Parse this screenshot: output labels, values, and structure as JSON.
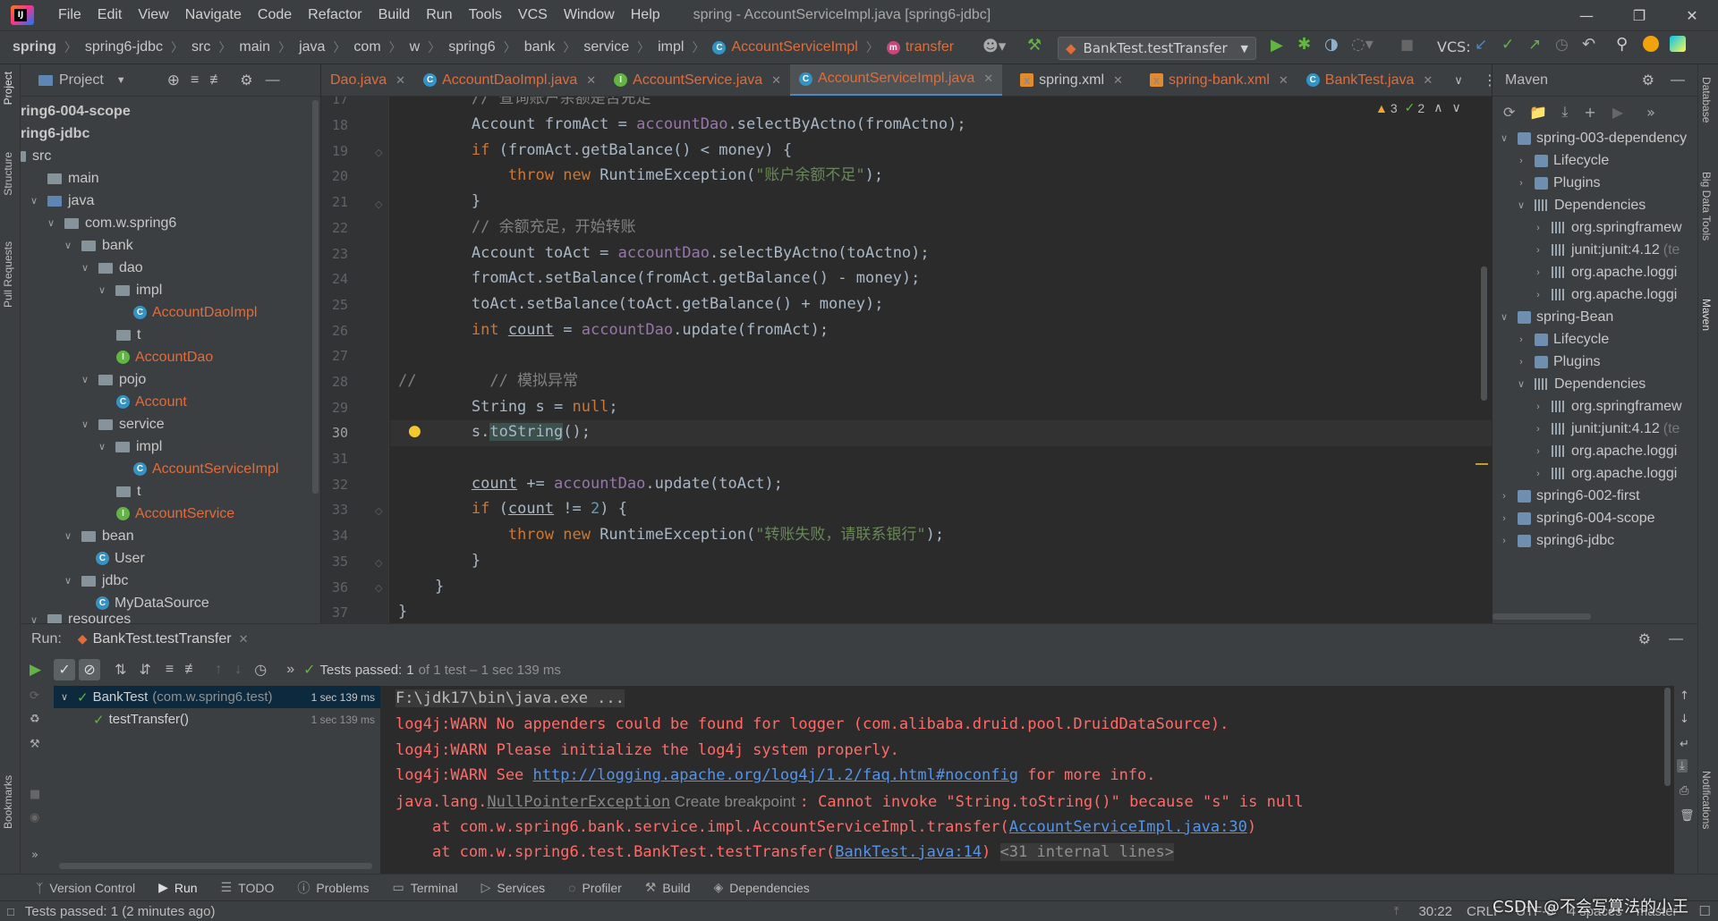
{
  "menubar": {
    "items": [
      "File",
      "Edit",
      "View",
      "Navigate",
      "Code",
      "Refactor",
      "Build",
      "Run",
      "Tools",
      "VCS",
      "Window",
      "Help"
    ],
    "title": "spring - AccountServiceImpl.java [spring6-jdbc]"
  },
  "navbar": {
    "crumbs": [
      "spring",
      "spring6-jdbc",
      "src",
      "main",
      "java",
      "com",
      "w",
      "spring6",
      "bank",
      "service",
      "impl"
    ],
    "class_crumb": "AccountServiceImpl",
    "method_crumb": "transfer",
    "run_config": "BankTest.testTransfer",
    "vcs_label": "VCS:"
  },
  "left_strip": {
    "tabs": [
      "Project",
      "Structure",
      "Pull Requests",
      "Bookmarks"
    ]
  },
  "project": {
    "title": "Project",
    "rows": [
      "ring6-004-scope",
      "ring6-jdbc",
      "src",
      "main",
      "java",
      "com.w.spring6",
      "bank",
      "dao",
      "impl",
      "AccountDaoImpl",
      "t",
      "AccountDao",
      "pojo",
      "Account",
      "service",
      "impl",
      "AccountServiceImpl",
      "t",
      "AccountService",
      "bean",
      "User",
      "jdbc",
      "MyDataSource",
      "resources"
    ]
  },
  "tabs": [
    {
      "name": "Dao.java"
    },
    {
      "name": "AccountDaoImpl.java"
    },
    {
      "name": "AccountService.java"
    },
    {
      "name": "AccountServiceImpl.java"
    },
    {
      "name": "spring.xml"
    },
    {
      "name": "spring-bank.xml"
    },
    {
      "name": "BankTest.java"
    }
  ],
  "editor": {
    "warnings": "3",
    "weak_warnings": "2",
    "line_numbers": [
      "17",
      "18",
      "19",
      "20",
      "21",
      "22",
      "23",
      "24",
      "25",
      "26",
      "27",
      "28",
      "29",
      "30",
      "31",
      "32",
      "33",
      "34",
      "35",
      "36",
      "37"
    ],
    "current_line": "30"
  },
  "maven": {
    "title": "Maven",
    "rows": [
      "spring-003-dependency",
      "Lifecycle",
      "Plugins",
      "Dependencies",
      "org.springframew",
      "junit:junit:4.12",
      "org.apache.loggi",
      "org.apache.loggi",
      "spring-Bean",
      "Lifecycle",
      "Plugins",
      "Dependencies",
      "org.springframew",
      "junit:junit:4.12",
      "org.apache.loggi",
      "org.apache.loggi",
      "spring6-002-first",
      "spring6-004-scope",
      "spring6-jdbc"
    ],
    "junit_suffix": "(te"
  },
  "right_strip": {
    "tabs": [
      "Database",
      "Big Data Tools",
      "Maven",
      "Notifications"
    ]
  },
  "run": {
    "label": "Run:",
    "tab": "BankTest.testTransfer",
    "status": "Tests passed:",
    "status_count": "1",
    "status_rest": "of 1 test – 1 sec 139 ms",
    "tree": [
      {
        "name": "BankTest",
        "detail": "(com.w.spring6.test)",
        "time": "1 sec 139 ms"
      },
      {
        "name": "testTransfer()",
        "detail": "",
        "time": "1 sec 139 ms"
      }
    ],
    "console": {
      "cmd": "F:\\jdk17\\bin\\java.exe ...",
      "warn1": "log4j:WARN No appenders could be found for logger (com.alibaba.druid.pool.DruidDataSource).",
      "warn2": "log4j:WARN Please initialize the log4j system properly.",
      "warn3_pre": "log4j:WARN See ",
      "warn3_link": "http://logging.apache.org/log4j/1.2/faq.html#noconfig",
      "warn3_post": " for more info.",
      "exc_pre": "java.lang.",
      "exc_name": "NullPointerException",
      "exc_bp": " Create breakpoint ",
      "exc_msg": ": Cannot invoke \"String.toString()\" because \"s\" is null",
      "at1_pre": "    at com.w.spring6.bank.service.impl.AccountServiceImpl.transfer(",
      "at1_link": "AccountServiceImpl.java:30",
      "at1_post": ")",
      "at2_pre": "    at com.w.spring6.test.BankTest.testTransfer(",
      "at2_link": "BankTest.java:14",
      "at2_post": ")",
      "at2_internal": "<31 internal lines>"
    }
  },
  "bottom_tabs": [
    "Version Control",
    "Run",
    "TODO",
    "Problems",
    "Terminal",
    "Services",
    "Profiler",
    "Build",
    "Dependencies"
  ],
  "statusbar": {
    "message": "Tests passed: 1 (2 minutes ago)",
    "position": "30:22",
    "line_sep": "CRLF",
    "encoding": "UTF-8",
    "indent": "4 spaces",
    "branch": "master",
    "watermark": "CSDN @不会写算法的小王"
  },
  "colors": {
    "accent": "#4a88c7",
    "error": "#ff6b68",
    "link": "#5394ec",
    "class": "#e06c3a",
    "pass": "#62b543"
  }
}
